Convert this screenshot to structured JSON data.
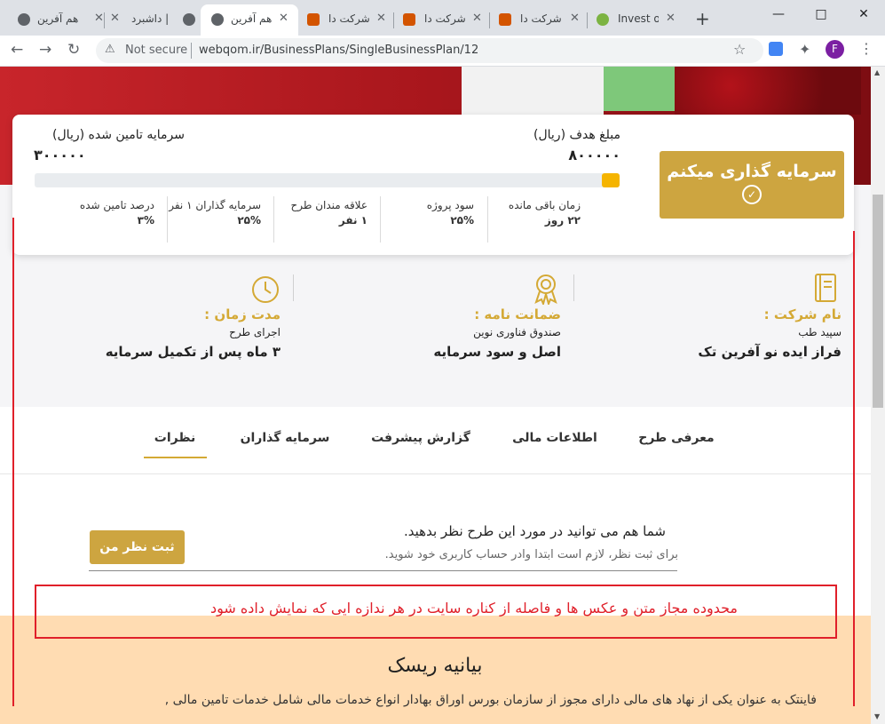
{
  "browser": {
    "tabs": [
      {
        "title": "هم آفرین",
        "active": false
      },
      {
        "title": "داشبرد |",
        "active": false
      },
      {
        "title": "هم آفرین",
        "active": true
      },
      {
        "title": "شرکت دا",
        "active": false
      },
      {
        "title": "شرکت دا",
        "active": false
      },
      {
        "title": "شرکت دا",
        "active": false
      },
      {
        "title": "Invest or",
        "active": false
      }
    ],
    "new_tab": "+",
    "security_label": "Not secure",
    "url": "webqom.ir/BusinessPlans/SingleBusinessPlan/12",
    "profile_initial": "F",
    "colors": {
      "tabstrip": "#dee1e6",
      "profile": "#7b1fa2"
    }
  },
  "funding": {
    "target_label": "مبلغ هدف (ریال)",
    "target_value": "۸۰۰۰۰۰",
    "raised_label": "سرمایه تامین شده (ریال)",
    "raised_value": "۳۰۰۰۰۰",
    "progress_percent": 3,
    "invest_button": "سرمایه گذاری میکنم",
    "stats": [
      {
        "label": "زمان باقی مانده",
        "value": "۲۲ روز"
      },
      {
        "label": "سود پروژه",
        "value": "۲۵%"
      },
      {
        "label": "علاقه مندان طرح",
        "value": "۱ نفر"
      },
      {
        "label": "سرمایه گذاران ۱ نفر",
        "value": "۲۵%"
      },
      {
        "label": "درصد تامین شده",
        "value": "۳%"
      }
    ]
  },
  "info": [
    {
      "title": "نام شرکت :",
      "line1": "سپید طب",
      "line2": "فراز ایده نو آفرین تک",
      "icon": "notebook-icon"
    },
    {
      "title": "ضمانت نامه :",
      "line1": "صندوق فناوری نوین",
      "line2": "اصل و سود سرمایه",
      "icon": "award-icon"
    },
    {
      "title": "مدت زمان :",
      "line1": "اجرای طرح",
      "line2": "۳ ماه پس از تکمیل سرمایه",
      "icon": "clock-icon"
    }
  ],
  "tabs": [
    {
      "label": "معرفی طرح",
      "active": false
    },
    {
      "label": "اطلاعات مالی",
      "active": false
    },
    {
      "label": "گزارش پیشرفت",
      "active": false
    },
    {
      "label": "سرمایه گذاران",
      "active": false
    },
    {
      "label": "نظرات",
      "active": true
    }
  ],
  "comments": {
    "heading": "شما هم می توانید در مورد این طرح نظر بدهید.",
    "note": "برای ثبت نظر، لازم است ابتدا وادر حساب کاربری خود شوید.",
    "button": "ثبت نظر من"
  },
  "annotation": "محدوده مجاز متن و عکس ها  و فاصله از کناره سایت در هر ندازه ایی که نمایش داده شود",
  "risk": {
    "title": "بیانیه ریسک",
    "text": "فاینتک به عنوان یکی از نهاد های مالی دارای مجوز از سازمان بورس اوراق بهادار انواع خدمات مالی شامل خدمات تامین مالی ,"
  },
  "colors": {
    "gold": "#d4a935",
    "accent_red": "#e0202a",
    "risk_bg": "#ffdcb2"
  }
}
